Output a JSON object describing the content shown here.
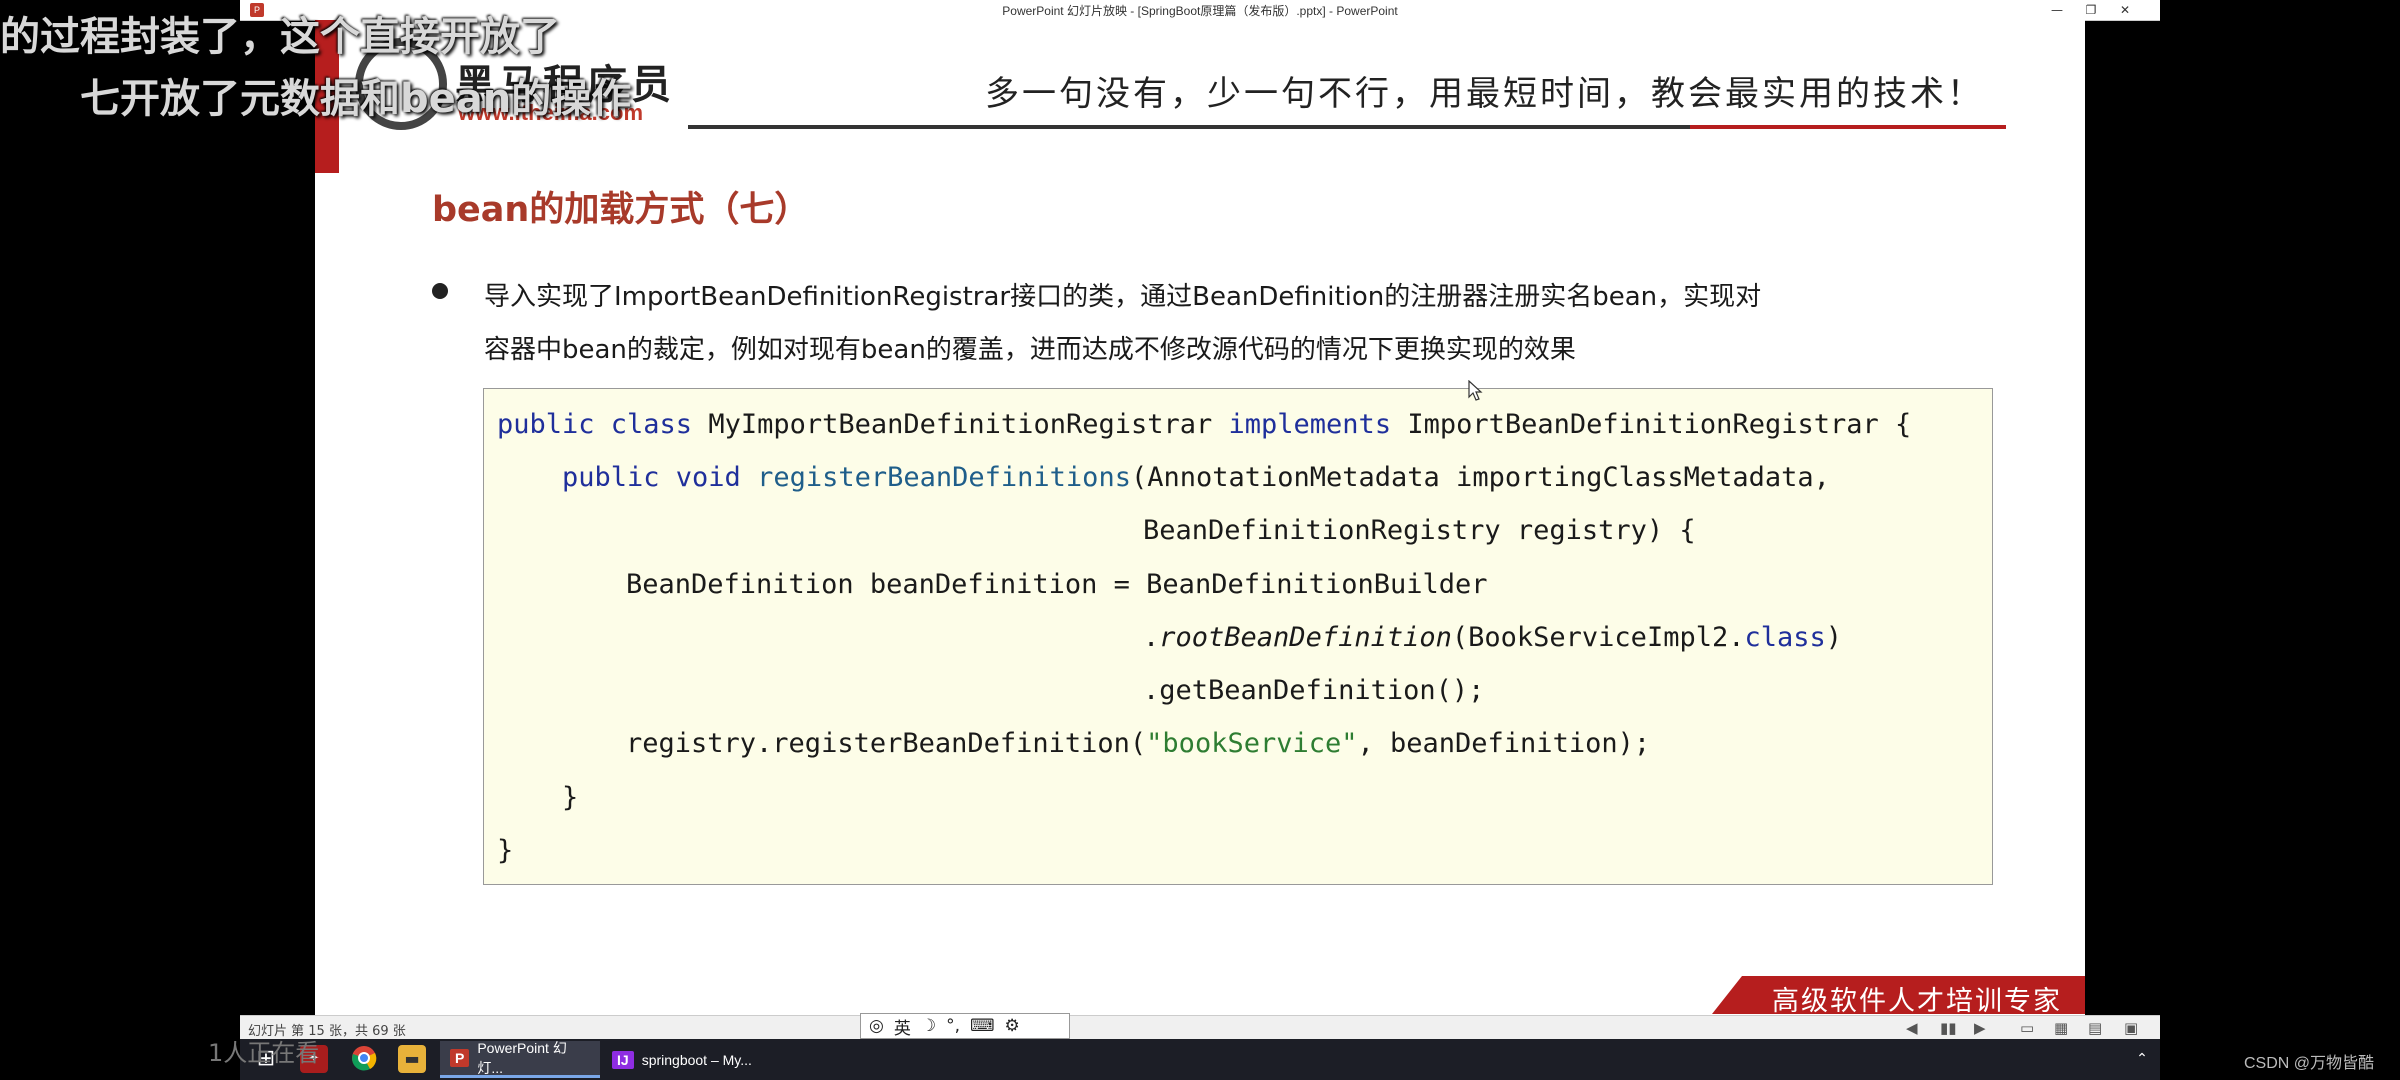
{
  "window": {
    "title": "PowerPoint 幻灯片放映 - [SpringBoot原理篇（发布版）.pptx] - PowerPoint",
    "controls": [
      "—",
      "❐",
      "✕"
    ]
  },
  "slide": {
    "logo_text": "黑马程序员",
    "logo_url": "www.itheima.com",
    "slogan": "多一句没有，少一句不行，用最短时间，教会最实用的技术！",
    "title": "bean的加载方式（七）",
    "bullet_lines": [
      "导入实现了ImportBeanDefinitionRegistrar接口的类，通过BeanDefinition的注册器注册实名bean，实现对",
      "容器中bean的裁定，例如对现有bean的覆盖，进而达成不修改源代码的情况下更换实现的效果"
    ],
    "code": {
      "l1_kw": "public class",
      "l1_name": " MyImportBeanDefinitionRegistrar ",
      "l1_impl": "implements",
      "l1_rest": " ImportBeanDefinitionRegistrar {",
      "l2_kw": "public void",
      "l2_fn": "registerBeanDefinitions",
      "l2_rest": "(AnnotationMetadata importingClassMetadata,",
      "l3": "BeanDefinitionRegistry registry) {",
      "l4": "BeanDefinition beanDefinition = BeanDefinitionBuilder",
      "l5_dot": ".",
      "l5_it": "rootBeanDefinition",
      "l5_mid": "(BookServiceImpl2.",
      "l5_kw": "class",
      "l5_end": ")",
      "l6": ".getBeanDefinition();",
      "l7_pre": "registry.registerBeanDefinition(",
      "l7_str": "\"bookService\"",
      "l7_post": ", beanDefinition);",
      "l8": "}",
      "l9": "}"
    },
    "footer_tag": "高级软件人才培训专家"
  },
  "subtitles": [
    "的过程封装了，这个直接开放了",
    "七开放了元数据和bean的操作"
  ],
  "statusbar": {
    "slide_count": "幻灯片 第 15 张，共 69 张",
    "ime_lang": "英"
  },
  "taskbar": {
    "tasks": [
      "PowerPoint 幻灯...",
      "springboot – My..."
    ],
    "people_overlay": "1人正在看",
    "watermark": "CSDN @万物皆酷"
  },
  "colors": {
    "accent_red": "#b61e1e",
    "title_red": "#a83a2a",
    "code_bg": "#fdfde8",
    "keyword_blue": "#1f2f9b",
    "string_green": "#2e7d32"
  }
}
